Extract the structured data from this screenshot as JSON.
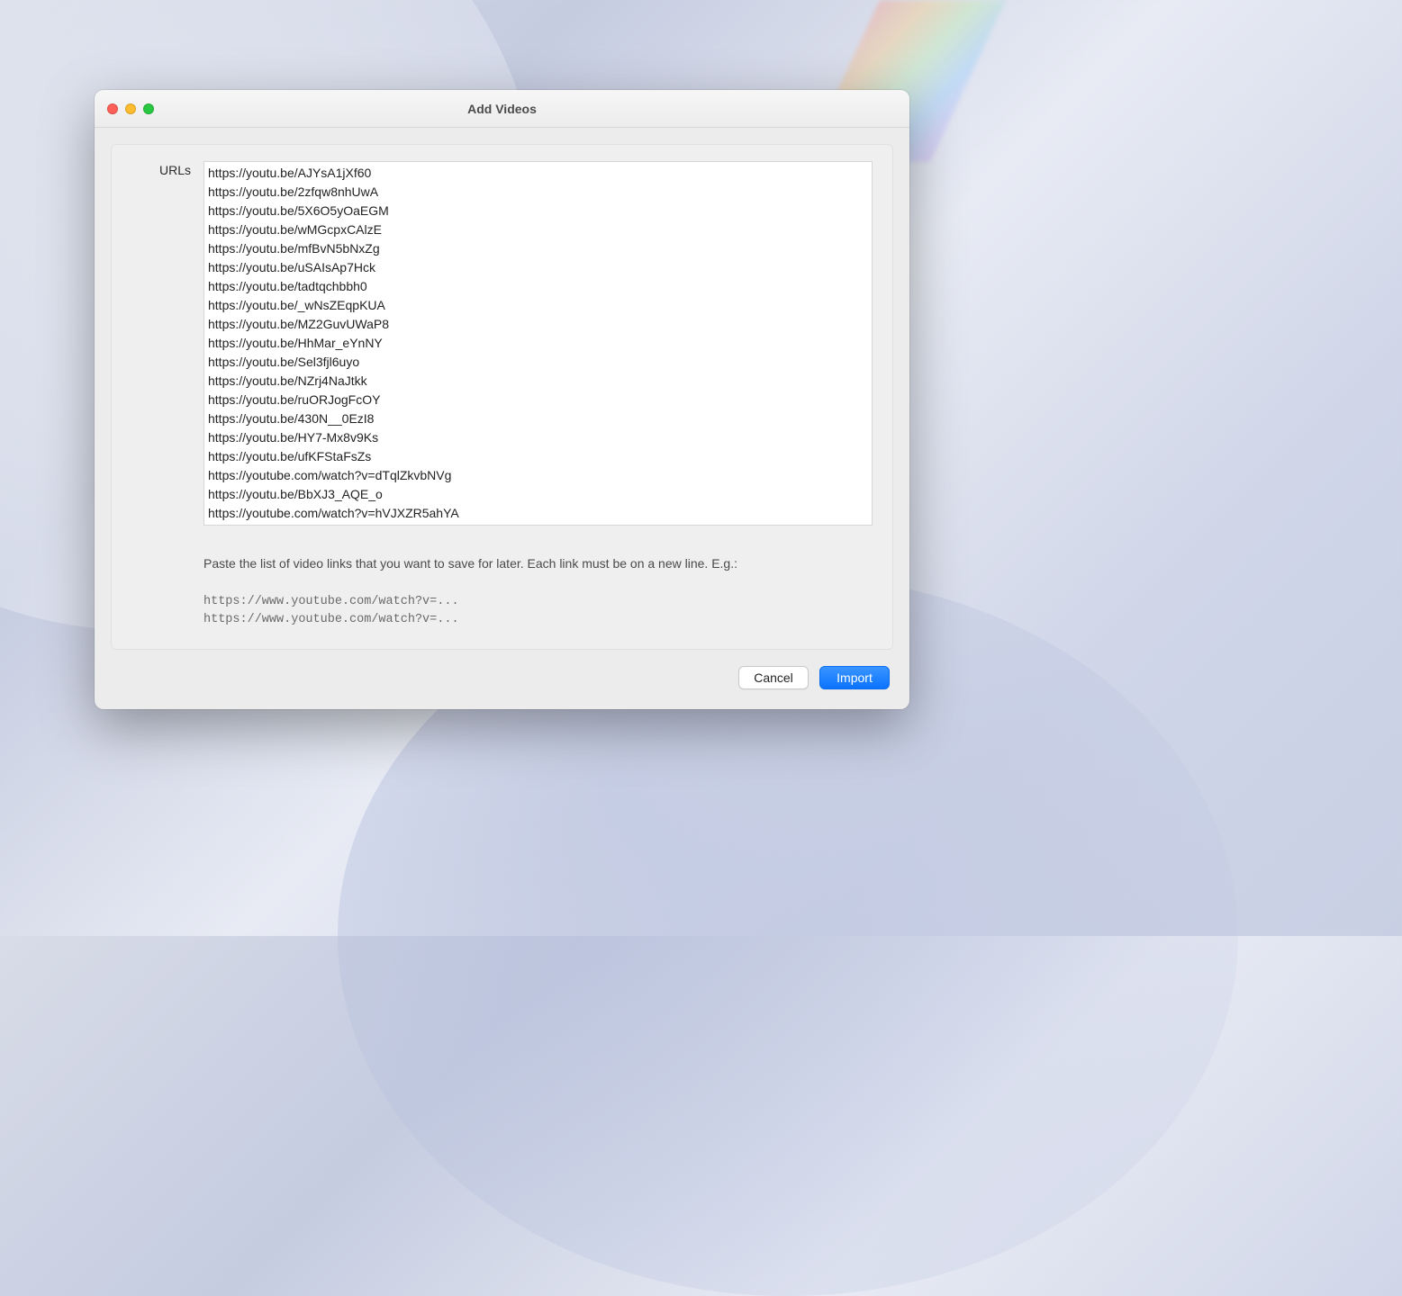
{
  "window": {
    "title": "Add Videos"
  },
  "form": {
    "label": "URLs",
    "textarea_value": "https://youtu.be/AJYsA1jXf60\nhttps://youtu.be/2zfqw8nhUwA\nhttps://youtu.be/5X6O5yOaEGM\nhttps://youtu.be/wMGcpxCAlzE\nhttps://youtu.be/mfBvN5bNxZg\nhttps://youtu.be/uSAIsAp7Hck\nhttps://youtu.be/tadtqchbbh0\nhttps://youtu.be/_wNsZEqpKUA\nhttps://youtu.be/MZ2GuvUWaP8\nhttps://youtu.be/HhMar_eYnNY\nhttps://youtu.be/Sel3fjl6uyo\nhttps://youtu.be/NZrj4NaJtkk\nhttps://youtu.be/ruORJogFcOY\nhttps://youtu.be/430N__0EzI8\nhttps://youtu.be/HY7-Mx8v9Ks\nhttps://youtu.be/ufKFStaFsZs\nhttps://youtube.com/watch?v=dTqlZkvbNVg\nhttps://youtu.be/BbXJ3_AQE_o\nhttps://youtube.com/watch?v=hVJXZR5ahYA",
    "help_text": "Paste the list of video links that you want to save for later. Each link must be on a new line. E.g.:",
    "example_text": "https://www.youtube.com/watch?v=...\nhttps://www.youtube.com/watch?v=..."
  },
  "buttons": {
    "cancel": "Cancel",
    "import": "Import"
  }
}
